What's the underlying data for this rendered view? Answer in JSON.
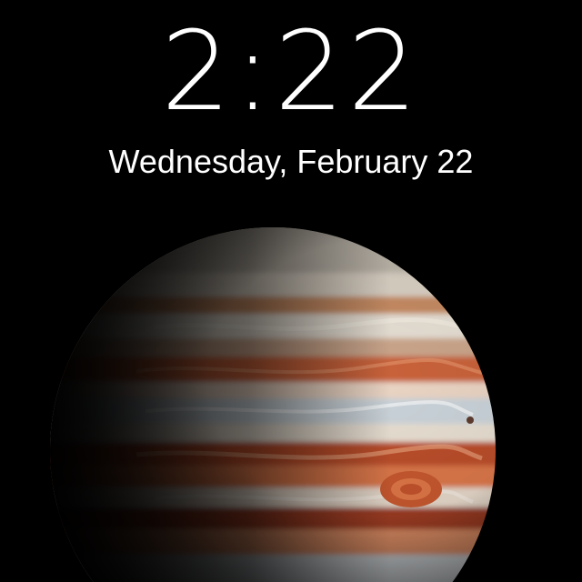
{
  "lock_screen": {
    "time": "2:22",
    "date": "Wednesday, February 22"
  },
  "wallpaper": {
    "subject": "jupiter",
    "colors": {
      "background": "#000000",
      "band_cream": "#e6ddd0",
      "band_orange": "#c8623a",
      "band_deep": "#9a3a22",
      "band_pale_blue": "#c9d2d8",
      "shadow": "#000000"
    }
  }
}
